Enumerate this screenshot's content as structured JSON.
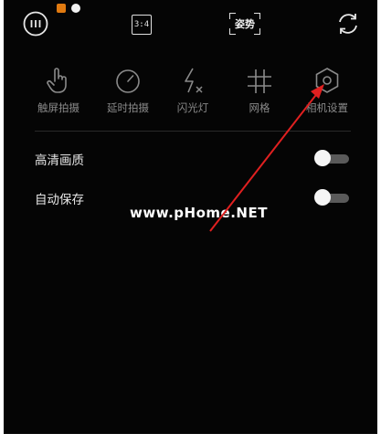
{
  "topbar": {
    "ratio_label": "3:4",
    "pose_label": "姿势"
  },
  "menu": {
    "items": [
      {
        "label": "触屏拍摄",
        "icon": "touch-hand-icon"
      },
      {
        "label": "延时拍摄",
        "icon": "timer-dial-icon"
      },
      {
        "label": "闪光灯",
        "icon": "flash-off-icon"
      },
      {
        "label": "网格",
        "icon": "grid-icon"
      },
      {
        "label": "相机设置",
        "icon": "hexagon-settings-icon"
      }
    ]
  },
  "settings": [
    {
      "label": "高清画质",
      "enabled": false
    },
    {
      "label": "自动保存",
      "enabled": false
    }
  ],
  "watermark": "www.pHome.NET",
  "colors": {
    "background": "#050505",
    "text_primary": "#e6e6e6",
    "text_secondary": "#8a8a8a",
    "annotation_arrow": "#e02020",
    "toggle_track": "#5a5a5a"
  }
}
